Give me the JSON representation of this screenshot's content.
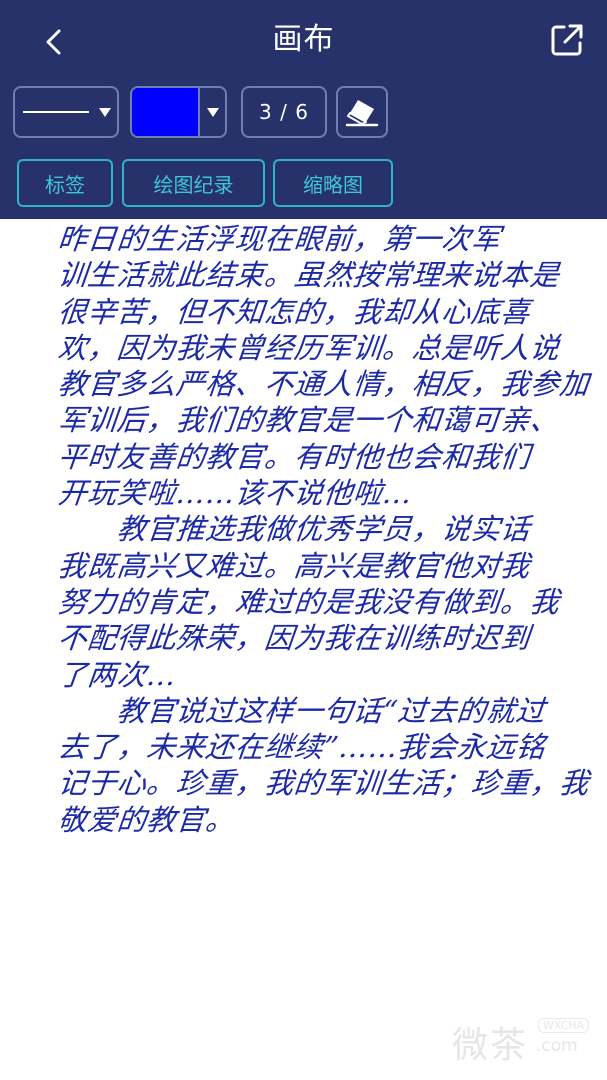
{
  "header": {
    "title": "画布",
    "back_icon": "chevron-left-icon",
    "share_icon": "external-share-icon"
  },
  "toolbar": {
    "stroke_icon": "line-stroke-icon",
    "color": "#0000ff",
    "page_counter": "3 / 6",
    "eraser_icon": "eraser-icon"
  },
  "tabs": [
    {
      "label": "标签"
    },
    {
      "label": "绘图纪录"
    },
    {
      "label": "缩略图"
    }
  ],
  "canvas": {
    "ink_color": "#1d2aa6",
    "lines": [
      "昨日的生活浮现在眼前，第一次军",
      "训生活就此结束。虽然按常理来说本是",
      "很辛苦，但不知怎的，我却从心底喜",
      "欢，因为我未曾经历军训。总是听人说",
      "教官多么严格、不通人情，相反，我参加",
      "军训后，我们的教官是一个和蔼可亲、",
      "平时友善的教官。有时他也会和我们",
      "开玩笑啦……该不说他啦…",
      "　　教官推选我做优秀学员，说实话",
      "我既高兴又难过。高兴是教官他对我",
      "努力的肯定，难过的是我没有做到。我",
      "不配得此殊荣，因为我在训练时迟到",
      "了两次…",
      "　　教官说过这样一句话“过去的就过",
      "去了，未来还在继续”……我会永远铭",
      "记于心。珍重，我的军训生活；珍重，我",
      "敬爱的教官。"
    ]
  },
  "watermark": {
    "main": "微茶",
    "badge": "WXCHA",
    "domain": ".com"
  }
}
